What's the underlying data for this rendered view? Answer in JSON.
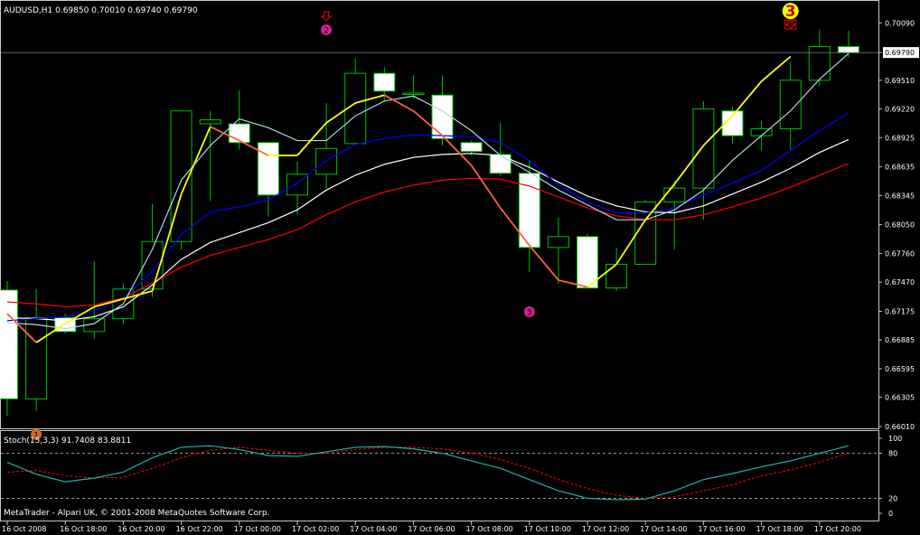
{
  "colors": {
    "background": "#000000",
    "frame": "#c8c8c8",
    "bull_candle": "#00c000",
    "bear_body": "#ffffff",
    "ma_fast": "#add8e6",
    "ma_blue": "#0000ff",
    "ma_white": "#ffffff",
    "ma_red": "#ff0000",
    "zigzag_up": "#ffff00",
    "zigzag_down": "#ff6040",
    "stoch_main": "#20b2aa",
    "stoch_signal": "#ff0000",
    "price_line": "#c8c8c8",
    "marker_magenta": "#d02090",
    "marker_orange": "#d2691e",
    "marker_yellow": "#ffff00"
  },
  "header": {
    "symbol_info": "AUDUSD,H1  0.69850 0.70010 0.69740 0.69790"
  },
  "subwindow": {
    "label": "Stoch(15,3,3) 91.7408 83.8811"
  },
  "footer": {
    "copyright": "MetaTrader - Alpari UK, © 2001-2008 MetaQuotes Software Corp."
  },
  "markers": [
    {
      "label": "1",
      "kind": "circle",
      "color": "orange",
      "bar": 1,
      "price": 0.6593,
      "arrow": false
    },
    {
      "label": "2",
      "kind": "circle",
      "color": "magenta",
      "bar": 11,
      "price": 0.7002,
      "arrow": true
    },
    {
      "label": "3",
      "kind": "circle",
      "color": "magenta",
      "bar": 18,
      "price": 0.6717,
      "arrow": false
    },
    {
      "label": "3",
      "kind": "big",
      "color": "yellow",
      "bar": 27,
      "price": 0.7021,
      "arrow": true
    }
  ],
  "chart_data": [
    {
      "type": "candlestick",
      "symbol": "AUDUSD",
      "timeframe": "H1",
      "ylim": [
        0.6601,
        0.7012
      ],
      "price_line": 0.6979,
      "current_price_label": "0.69790",
      "y_ticks": [
        0.7009,
        0.6979,
        0.6951,
        0.6922,
        0.6893,
        0.68635,
        0.68345,
        0.6805,
        0.6776,
        0.6747,
        0.67175,
        0.66885,
        0.66595,
        0.66305,
        0.6601
      ],
      "y_tick_labels": [
        "0.70090",
        "0.69790",
        "0.69510",
        "0.69220",
        "0.68925",
        "0.68635",
        "0.68345",
        "0.68050",
        "0.67760",
        "0.67470",
        "0.67175",
        "0.66885",
        "0.66595",
        "0.66305",
        "0.66010"
      ],
      "x_tick_labels": [
        "16 Oct 2008",
        "16 Oct 18:00",
        "16 Oct 20:00",
        "16 Oct 22:00",
        "17 Oct 00:00",
        "17 Oct 02:00",
        "17 Oct 04:00",
        "17 Oct 06:00",
        "17 Oct 08:00",
        "17 Oct 10:00",
        "17 Oct 12:00",
        "17 Oct 14:00",
        "17 Oct 16:00",
        "17 Oct 18:00",
        "17 Oct 20:00"
      ],
      "x_tick_bars": [
        0,
        2,
        4,
        6,
        8,
        10,
        12,
        14,
        16,
        18,
        20,
        22,
        24,
        26,
        28
      ],
      "candles": [
        {
          "o": 0.6739,
          "h": 0.6748,
          "l": 0.6612,
          "c": 0.6629
        },
        {
          "o": 0.6629,
          "h": 0.674,
          "l": 0.6617,
          "c": 0.6711
        },
        {
          "o": 0.6711,
          "h": 0.6715,
          "l": 0.6695,
          "c": 0.6697
        },
        {
          "o": 0.6697,
          "h": 0.6768,
          "l": 0.669,
          "c": 0.671
        },
        {
          "o": 0.671,
          "h": 0.6746,
          "l": 0.6704,
          "c": 0.674
        },
        {
          "o": 0.674,
          "h": 0.6826,
          "l": 0.6732,
          "c": 0.6788
        },
        {
          "o": 0.6788,
          "h": 0.692,
          "l": 0.678,
          "c": 0.692
        },
        {
          "o": 0.6907,
          "h": 0.692,
          "l": 0.6829,
          "c": 0.6911
        },
        {
          "o": 0.6907,
          "h": 0.6941,
          "l": 0.6881,
          "c": 0.6888
        },
        {
          "o": 0.6888,
          "h": 0.6888,
          "l": 0.6813,
          "c": 0.6835
        },
        {
          "o": 0.6835,
          "h": 0.6869,
          "l": 0.6815,
          "c": 0.6856
        },
        {
          "o": 0.6856,
          "h": 0.6928,
          "l": 0.6842,
          "c": 0.6882
        },
        {
          "o": 0.6887,
          "h": 0.6973,
          "l": 0.6887,
          "c": 0.6958
        },
        {
          "o": 0.6958,
          "h": 0.6964,
          "l": 0.693,
          "c": 0.694
        },
        {
          "o": 0.6938,
          "h": 0.6956,
          "l": 0.6932,
          "c": 0.6938
        },
        {
          "o": 0.6936,
          "h": 0.6956,
          "l": 0.6885,
          "c": 0.6892
        },
        {
          "o": 0.6888,
          "h": 0.689,
          "l": 0.6875,
          "c": 0.6879
        },
        {
          "o": 0.6876,
          "h": 0.6908,
          "l": 0.6855,
          "c": 0.6857
        },
        {
          "o": 0.6857,
          "h": 0.687,
          "l": 0.6757,
          "c": 0.6782
        },
        {
          "o": 0.6782,
          "h": 0.6812,
          "l": 0.6745,
          "c": 0.6793
        },
        {
          "o": 0.6793,
          "h": 0.6796,
          "l": 0.6743,
          "c": 0.6741
        },
        {
          "o": 0.6741,
          "h": 0.6782,
          "l": 0.6738,
          "c": 0.6765
        },
        {
          "o": 0.6765,
          "h": 0.683,
          "l": 0.6765,
          "c": 0.6828
        },
        {
          "o": 0.6828,
          "h": 0.685,
          "l": 0.678,
          "c": 0.6842
        },
        {
          "o": 0.6842,
          "h": 0.693,
          "l": 0.681,
          "c": 0.6922
        },
        {
          "o": 0.692,
          "h": 0.6924,
          "l": 0.6887,
          "c": 0.6895
        },
        {
          "o": 0.6895,
          "h": 0.691,
          "l": 0.688,
          "c": 0.6902
        },
        {
          "o": 0.6902,
          "h": 0.697,
          "l": 0.688,
          "c": 0.6951
        },
        {
          "o": 0.6951,
          "h": 0.7002,
          "l": 0.6945,
          "c": 0.6985
        },
        {
          "o": 0.6985,
          "h": 0.7001,
          "l": 0.6974,
          "c": 0.6979
        }
      ],
      "moving_averages": [
        {
          "color": "lightblue",
          "values": [
            0.6706,
            0.6704,
            0.67,
            0.6705,
            0.6725,
            0.678,
            0.685,
            0.6885,
            0.6912,
            0.6903,
            0.689,
            0.689,
            0.6915,
            0.693,
            0.6935,
            0.692,
            0.69,
            0.6875,
            0.6858,
            0.684,
            0.6825,
            0.681,
            0.681,
            0.682,
            0.684,
            0.687,
            0.6895,
            0.692,
            0.6952,
            0.6978
          ]
        },
        {
          "color": "blue",
          "values": [
            0.6708,
            0.671,
            0.6712,
            0.6718,
            0.673,
            0.6758,
            0.6795,
            0.6818,
            0.6823,
            0.683,
            0.6847,
            0.687,
            0.6886,
            0.6892,
            0.6896,
            0.6895,
            0.6894,
            0.6888,
            0.687,
            0.6845,
            0.6828,
            0.6817,
            0.6817,
            0.6822,
            0.6835,
            0.6847,
            0.686,
            0.688,
            0.69,
            0.6918
          ]
        },
        {
          "color": "white",
          "values": [
            0.6711,
            0.671,
            0.6708,
            0.6712,
            0.6722,
            0.6744,
            0.677,
            0.6787,
            0.6797,
            0.6807,
            0.682,
            0.684,
            0.6855,
            0.6866,
            0.6873,
            0.6876,
            0.6877,
            0.6875,
            0.6863,
            0.6848,
            0.6834,
            0.6824,
            0.6818,
            0.6817,
            0.6824,
            0.6836,
            0.6848,
            0.6862,
            0.6878,
            0.6891
          ]
        },
        {
          "color": "red",
          "values": [
            0.6727,
            0.6725,
            0.6722,
            0.6724,
            0.6731,
            0.6746,
            0.6762,
            0.6774,
            0.6782,
            0.679,
            0.68,
            0.6815,
            0.6828,
            0.6838,
            0.6845,
            0.685,
            0.6852,
            0.6851,
            0.6844,
            0.6833,
            0.6822,
            0.6814,
            0.681,
            0.681,
            0.6815,
            0.6823,
            0.6832,
            0.6843,
            0.6855,
            0.6867
          ]
        }
      ],
      "zigzag": [
        {
          "bar": 0,
          "price": 0.6715
        },
        {
          "bar": 1,
          "price": 0.6686
        },
        {
          "bar": 2,
          "price": 0.6705
        },
        {
          "bar": 3,
          "price": 0.6722
        },
        {
          "bar": 5,
          "price": 0.6738
        },
        {
          "bar": 6,
          "price": 0.6836
        },
        {
          "bar": 7,
          "price": 0.6904
        },
        {
          "bar": 8,
          "price": 0.689
        },
        {
          "bar": 9,
          "price": 0.6875
        },
        {
          "bar": 10,
          "price": 0.6875
        },
        {
          "bar": 11,
          "price": 0.6908
        },
        {
          "bar": 12,
          "price": 0.6928
        },
        {
          "bar": 13,
          "price": 0.6936
        },
        {
          "bar": 14,
          "price": 0.692
        },
        {
          "bar": 15,
          "price": 0.6895
        },
        {
          "bar": 16,
          "price": 0.6865
        },
        {
          "bar": 17,
          "price": 0.6822
        },
        {
          "bar": 18,
          "price": 0.6784
        },
        {
          "bar": 19,
          "price": 0.6749
        },
        {
          "bar": 20,
          "price": 0.6742
        },
        {
          "bar": 21,
          "price": 0.6765
        },
        {
          "bar": 22,
          "price": 0.681
        },
        {
          "bar": 23,
          "price": 0.6846
        },
        {
          "bar": 24,
          "price": 0.6885
        },
        {
          "bar": 25,
          "price": 0.6915
        },
        {
          "bar": 26,
          "price": 0.695
        },
        {
          "bar": 27,
          "price": 0.6975
        }
      ]
    },
    {
      "type": "line",
      "title": "Stoch(15,3,3) 91.7408 83.8811",
      "ylim": [
        0,
        100
      ],
      "y_tick_labels": [
        "100",
        "80",
        "20",
        "0"
      ],
      "y_ticks": [
        100,
        80,
        20,
        0
      ],
      "levels": [
        80,
        20
      ],
      "series": [
        {
          "values": [
            68,
            52,
            42,
            47,
            55,
            74,
            88,
            90,
            85,
            77,
            76,
            82,
            88,
            89,
            86,
            80,
            70,
            60,
            45,
            30,
            20,
            18,
            19,
            30,
            45,
            53,
            62,
            70,
            80,
            90
          ]
        },
        {
          "values": [
            55,
            57,
            50,
            47,
            48,
            60,
            74,
            84,
            88,
            84,
            80,
            80,
            85,
            88,
            88,
            86,
            80,
            72,
            60,
            45,
            33,
            24,
            20,
            22,
            30,
            38,
            50,
            58,
            68,
            80
          ]
        }
      ]
    }
  ]
}
